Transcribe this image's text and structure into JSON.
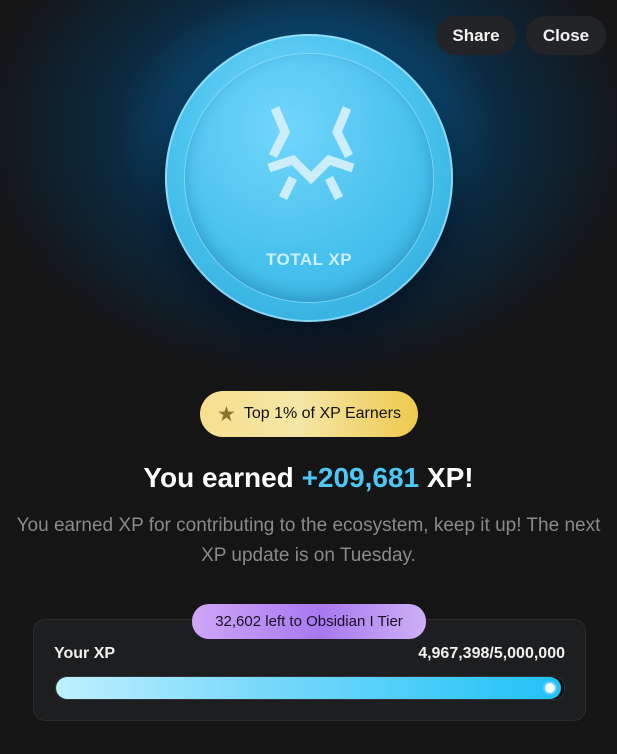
{
  "header": {
    "share_label": "Share",
    "close_label": "Close"
  },
  "coin": {
    "label": "TOTAL XP",
    "logo_icon": "total-xp-logo-icon"
  },
  "badge": {
    "icon": "star-icon",
    "text": "Top 1% of XP Earners"
  },
  "headline": {
    "prefix": "You earned",
    "amount": "+209,681",
    "suffix": "XP!"
  },
  "description": "You earned XP for contributing to the ecosystem, keep it up! The next XP update is on Tuesday.",
  "progress": {
    "tier_text": "32,602 left to Obsidian I Tier",
    "label": "Your XP",
    "value_text": "4,967,398/5,000,000",
    "current": 4967398,
    "target": 5000000
  },
  "colors": {
    "accent": "#4dc8f5",
    "background": "#151516",
    "badge_gold": "#f4e6a6",
    "tier_purple": "#b88af2"
  }
}
